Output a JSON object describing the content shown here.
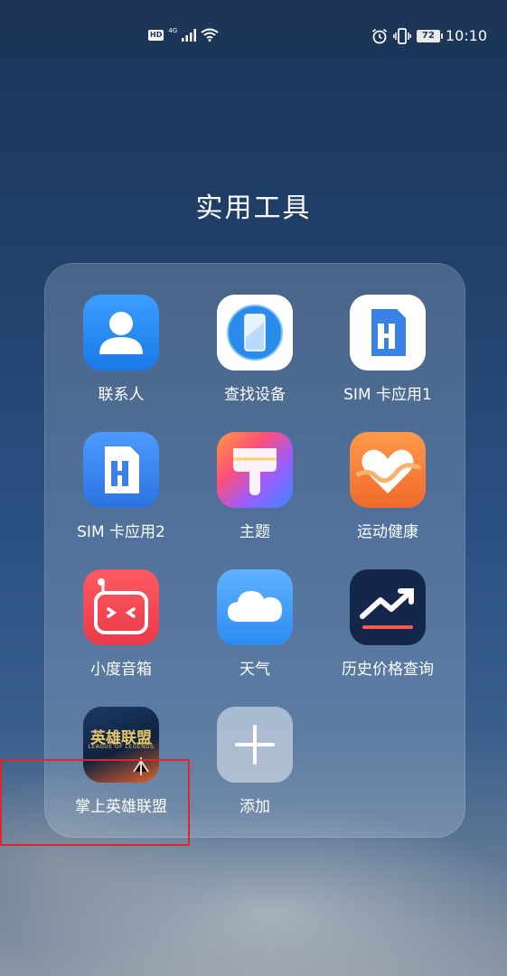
{
  "status_bar": {
    "hd": "HD",
    "network": "4G",
    "battery": "72",
    "time": "10:10",
    "icons": [
      "hd-icon",
      "signal-icon",
      "wifi-icon",
      "alarm-icon",
      "vibrate-icon",
      "battery-icon"
    ]
  },
  "folder": {
    "title": "实用工具",
    "apps": [
      {
        "label": "联系人",
        "icon": "contacts-icon"
      },
      {
        "label": "查找设备",
        "icon": "find-device-icon"
      },
      {
        "label": "SIM 卡应用1",
        "icon": "sim-card-icon"
      },
      {
        "label": "SIM 卡应用2",
        "icon": "sim-card-icon"
      },
      {
        "label": "主题",
        "icon": "theme-brush-icon"
      },
      {
        "label": "运动健康",
        "icon": "health-heart-icon"
      },
      {
        "label": "小度音箱",
        "icon": "speaker-face-icon"
      },
      {
        "label": "天气",
        "icon": "weather-cloud-icon"
      },
      {
        "label": "历史价格查询",
        "icon": "price-trend-icon"
      },
      {
        "label": "掌上英雄联盟",
        "icon": "league-of-legends-icon",
        "icon_text": "英雄联盟",
        "icon_subtext": "LEAGUE OF LEGENDS"
      },
      {
        "label": "添加",
        "icon": "plus-icon"
      }
    ]
  },
  "colors": {
    "highlight": "#e0262d",
    "contacts_bg": "#2d8cf0",
    "health_bg": "#f07a3a",
    "speaker_bg": "#ef4a56",
    "price_bg": "#14274a"
  }
}
